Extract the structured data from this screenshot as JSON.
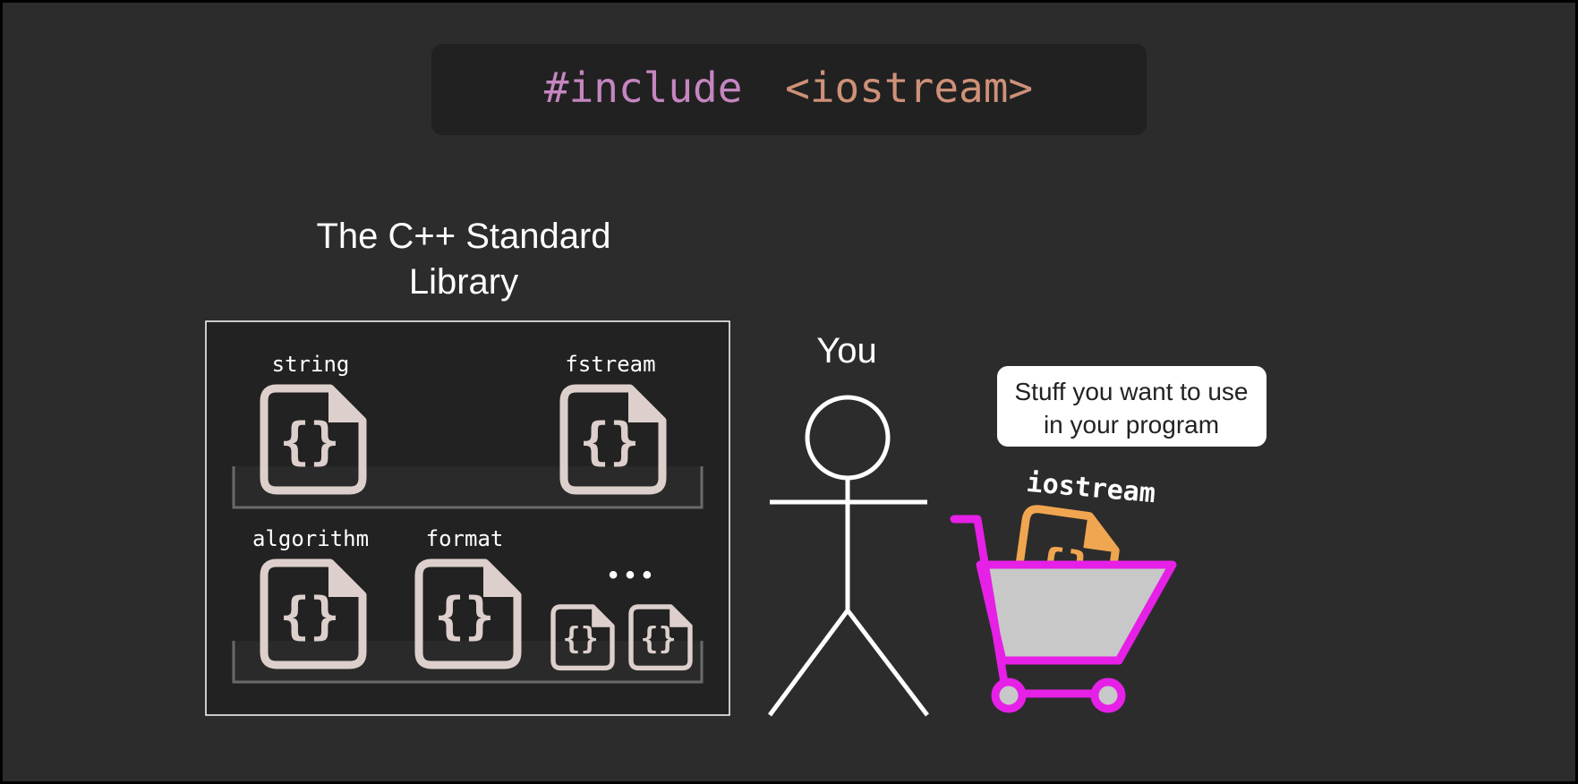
{
  "code_banner": {
    "directive": "#include",
    "header": "<iostream>",
    "directive_color": "#c586c0",
    "header_color": "#ce9178"
  },
  "library": {
    "title_line1": "The C++ Standard",
    "title_line2": "Library",
    "items": [
      {
        "label": "string",
        "icon": "curly-braces-file-icon"
      },
      {
        "label": "fstream",
        "icon": "curly-braces-file-icon"
      },
      {
        "label": "algorithm",
        "icon": "curly-braces-file-icon"
      },
      {
        "label": "format",
        "icon": "curly-braces-file-icon"
      }
    ],
    "more_label": "• • •"
  },
  "person": {
    "label": "You",
    "icon": "stick-figure-icon"
  },
  "cart": {
    "callout": "Stuff you want to use in your program",
    "callout_line1": "Stuff you want to use",
    "callout_line2": "in your program",
    "item_label": "iostream",
    "item_icon": "curly-braces-file-icon",
    "cart_icon": "shopping-cart-icon",
    "cart_color": "#e620e6",
    "item_color": "#f0a650"
  },
  "colors": {
    "background": "#2c2c2c",
    "panel": "#222222",
    "file_icon": "#ddd0cc",
    "text": "#ffffff"
  }
}
